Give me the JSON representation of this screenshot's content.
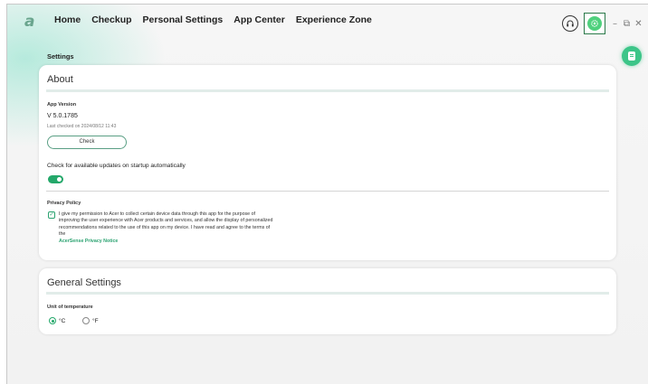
{
  "app": {
    "logo": "a",
    "nav": [
      "Home",
      "Checkup",
      "Personal Settings",
      "App Center",
      "Experience Zone"
    ]
  },
  "window_controls": {
    "minimize": "–",
    "restore": "⧉",
    "close": "✕"
  },
  "page": {
    "title": "Settings"
  },
  "about": {
    "heading": "About",
    "app_version_label": "App Version",
    "version": "V 5.0.1785",
    "last_checked": "Last checked on 2024/08/12 11:43",
    "check_button": "Check",
    "auto_update_label": "Check for available updates on startup automatically",
    "auto_update_on": true,
    "privacy_label": "Privacy Policy",
    "privacy_text": "I give my permission to Acer to collect certain device data through this app for the purpose of improving the user experience with Acer products and services, and allow the display of personalized recommendations related to the use of this app on my device. I have read and agree to the terms of the",
    "privacy_link": "AcerSense Privacy Notice",
    "privacy_checked": true
  },
  "general": {
    "heading": "General Settings",
    "temp_label": "Unit of temperature",
    "options": [
      "°C",
      "°F"
    ],
    "selected": "°C"
  },
  "colors": {
    "accent": "#24a86a",
    "gear_highlight": "#2b7a4a"
  },
  "icons": {
    "support": "headset-icon",
    "settings": "gear-icon",
    "side": "document-icon"
  }
}
